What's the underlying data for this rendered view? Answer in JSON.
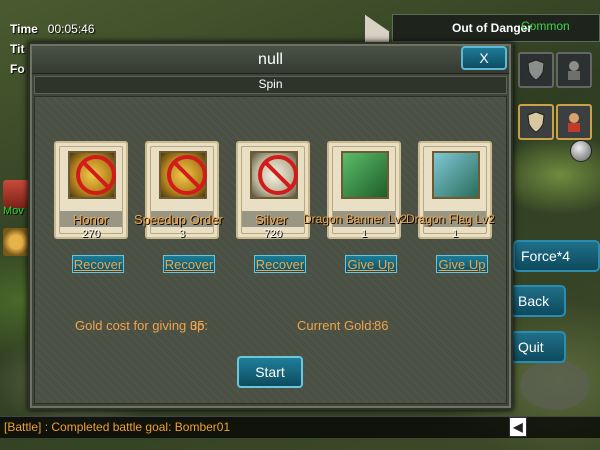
{
  "hud": {
    "time_label": "Time",
    "time_value": "00:05:46",
    "row2_label": "Tit",
    "row3_label": "Fo"
  },
  "top_right": {
    "title": "Out of Danger",
    "badge": "Common"
  },
  "left_edge": {
    "move_label": "Mov"
  },
  "side_buttons": {
    "force": "Force*4",
    "back": "Back",
    "quit": "Quit"
  },
  "battle_log": "[Battle] : Completed battle goal: Bomber01",
  "dialog": {
    "title": "null",
    "close": "X",
    "subtitle": "Spin",
    "items": [
      {
        "name": "Honor",
        "qty": "270",
        "action": "Recover",
        "icon": "honor-medal-icon",
        "blocked": true
      },
      {
        "name": "Speedup Order",
        "qty": "3",
        "action": "Recover",
        "icon": "speedup-order-icon",
        "blocked": true
      },
      {
        "name": "Silver",
        "qty": "720",
        "action": "Recover",
        "icon": "silver-coin-icon",
        "blocked": true
      },
      {
        "name": "Dragon Banner Lv2",
        "qty": "1",
        "action": "Give Up",
        "icon": "dragon-banner-icon",
        "blocked": false
      },
      {
        "name": "Dragon Flag Lv2",
        "qty": "1",
        "action": "Give Up",
        "icon": "dragon-flag-icon",
        "blocked": false
      }
    ],
    "gold_cost_label": "Gold cost for giving up:",
    "gold_cost_value": "35",
    "current_gold_label": "Current Gold:",
    "current_gold_value": "86",
    "start": "Start"
  }
}
